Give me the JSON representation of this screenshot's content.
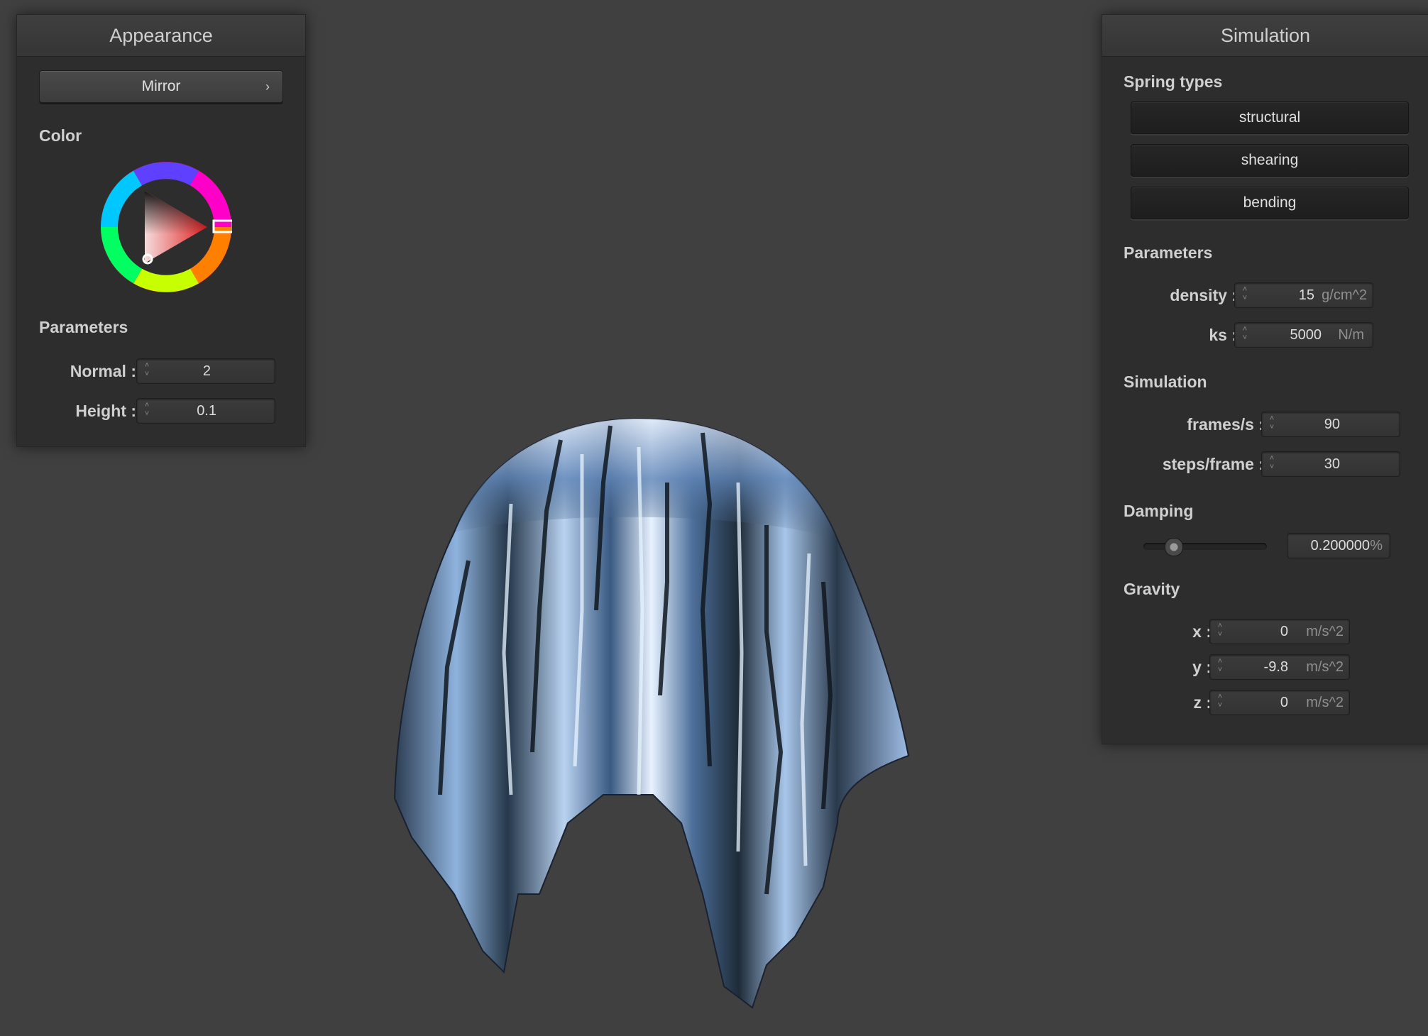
{
  "appearance": {
    "title": "Appearance",
    "shader_button": "Mirror",
    "color_label": "Color",
    "selected_color": "#d42a2a",
    "parameters_label": "Parameters",
    "normal": {
      "label": "Normal :",
      "value": "2"
    },
    "height": {
      "label": "Height :",
      "value": "0.1"
    }
  },
  "simulation": {
    "title": "Simulation",
    "spring_types_label": "Spring types",
    "spring_buttons": [
      "structural",
      "shearing",
      "bending"
    ],
    "parameters_label": "Parameters",
    "density": {
      "label": "density :",
      "value": "15",
      "unit": "g/cm^2"
    },
    "ks": {
      "label": "ks :",
      "value": "5000",
      "unit": "N/m"
    },
    "simulation_label": "Simulation",
    "frames_per_s": {
      "label": "frames/s :",
      "value": "90"
    },
    "steps_per_frame": {
      "label": "steps/frame :",
      "value": "30"
    },
    "damping_label": "Damping",
    "damping": {
      "value": "0.200000",
      "unit": "%",
      "slider_fraction": 0.2
    },
    "gravity_label": "Gravity",
    "gravity_x": {
      "label": "x :",
      "value": "0",
      "unit": "m/s^2"
    },
    "gravity_y": {
      "label": "y :",
      "value": "-9.8",
      "unit": "m/s^2"
    },
    "gravity_z": {
      "label": "z :",
      "value": "0",
      "unit": "m/s^2"
    }
  },
  "colors": {
    "background": "#404040",
    "panel": "#2d2d2d"
  }
}
